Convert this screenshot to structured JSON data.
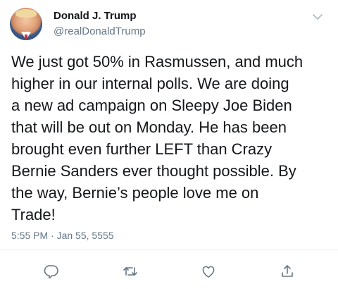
{
  "user": {
    "display_name": "Donald J. Trump",
    "handle": "@realDonaldTrump"
  },
  "tweet": {
    "text": "We just got 50% in Rasmussen, and much\nhigher in our internal polls. We are doing\na new ad campaign on Sleepy Joe Biden\nthat will be out on Monday. He has been\nbrought even further LEFT than Crazy\nBernie Sanders ever thought possible. By\nthe way, Bernie’s people love me on\nTrade!",
    "timestamp": "5:55 PM · Jan 55, 5555"
  },
  "actions": {
    "icons": [
      "reply-icon",
      "retweet-icon",
      "like-icon",
      "share-icon"
    ],
    "icon_color": "#657786"
  },
  "colors": {
    "text": "#14171a",
    "secondary": "#657786",
    "divider": "#e6ecf0"
  }
}
